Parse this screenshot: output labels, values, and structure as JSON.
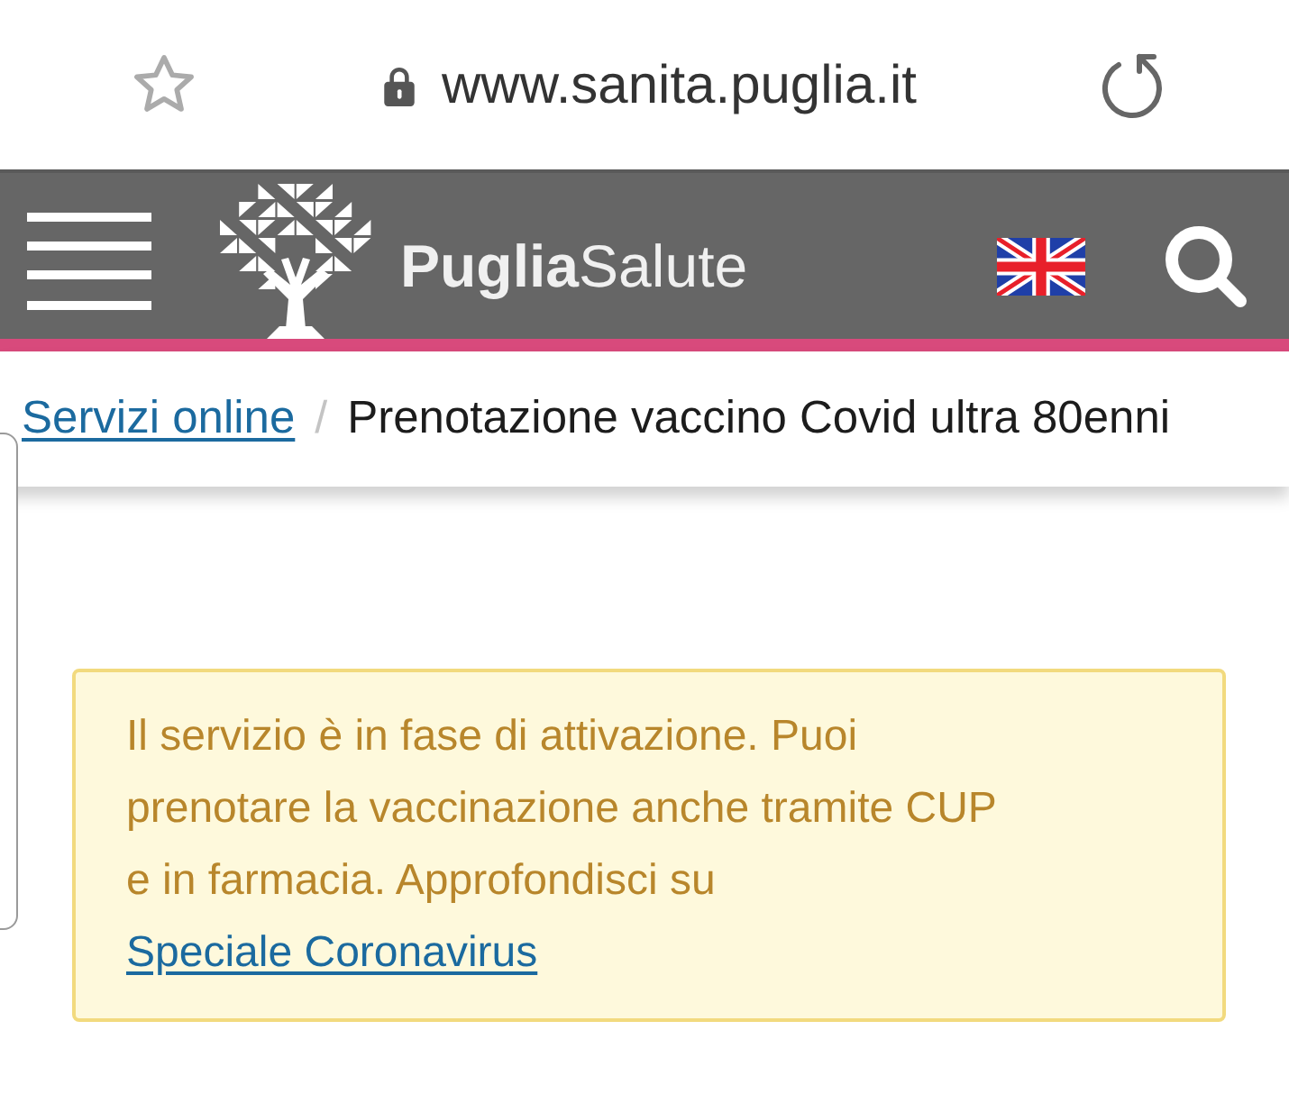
{
  "browser_bar": {
    "bookmarked": false,
    "secure": true,
    "url": "www.sanita.puglia.it"
  },
  "header": {
    "logo_text": "**Puglia**Salute"
  },
  "breadcrumb": {
    "separator": "/",
    "items": [
      {
        "label": "Servizi online",
        "link": true
      },
      {
        "label": "Prenotazione vaccino Covid ultra 80enni",
        "link": false
      }
    ]
  },
  "notice": {
    "text": "Il servizio è in fase di attivazione. Puoi prenotare la vaccinazione anche tramite CUP e in farmacia. Approfondisci su",
    "link_text": "Speciale Coronavirus"
  }
}
